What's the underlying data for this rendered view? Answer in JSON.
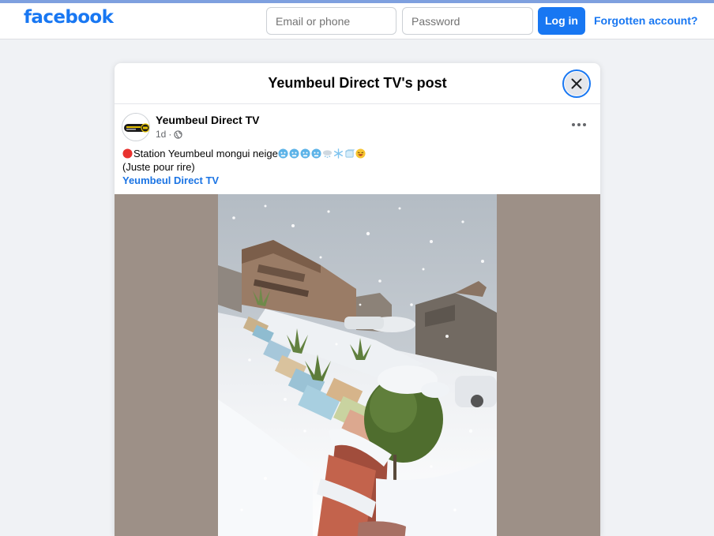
{
  "topbar": {
    "logo": "facebook",
    "email_placeholder": "Email or phone",
    "password_placeholder": "Password",
    "login_label": "Log in",
    "forgot_label": "Forgotten account?"
  },
  "modal": {
    "title": "Yeumbeul Direct TV's post"
  },
  "post": {
    "author": "Yeumbeul Direct TV",
    "time": "1d",
    "separator": "·",
    "line1": "Station Yeumbeul mongui neige",
    "line2": "(Juste pour rire)",
    "hashtag": "Yeumbeul Direct TV",
    "emoji_icons": [
      "red-circle-icon",
      "cold-face-icon",
      "cold-face-icon",
      "cold-face-icon",
      "cold-face-icon",
      "snow-cloud-icon",
      "snowflake-icon",
      "ice-cube-icon",
      "laughing-face-icon"
    ]
  },
  "colors": {
    "brand": "#1877f2",
    "background": "#f0f2f5",
    "media_backdrop": "#9d9087"
  }
}
